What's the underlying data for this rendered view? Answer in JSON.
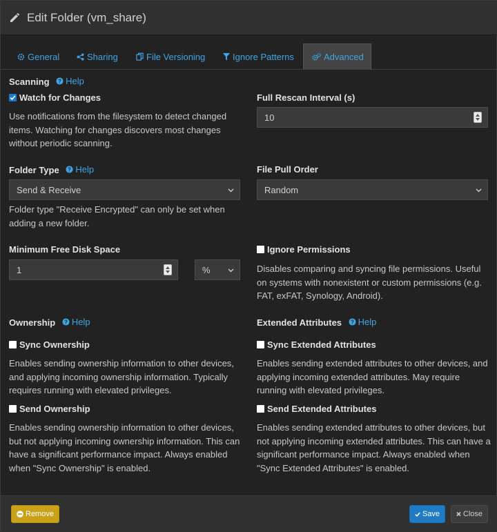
{
  "modal": {
    "title": "Edit Folder (vm_share)"
  },
  "tabs": [
    {
      "label": "General",
      "icon": "gear-icon"
    },
    {
      "label": "Sharing",
      "icon": "share-icon"
    },
    {
      "label": "File Versioning",
      "icon": "files-icon"
    },
    {
      "label": "Ignore Patterns",
      "icon": "filter-icon"
    },
    {
      "label": "Advanced",
      "icon": "cogs-icon",
      "active": true
    }
  ],
  "help_label": "Help",
  "scanning": {
    "label": "Scanning",
    "watch_label": "Watch for Changes",
    "watch_checked": true,
    "watch_description_lines": [
      "Use notifications from the filesystem to detect changed",
      "items. Watching for changes discovers most changes",
      "without periodic scanning."
    ]
  },
  "rescan": {
    "label": "Full Rescan Interval (s)",
    "value": "10"
  },
  "folder_type": {
    "label": "Folder Type",
    "value": "Send & Receive",
    "note_lines": [
      "Folder type \"Receive Encrypted\" can only be set when",
      "adding a new folder."
    ]
  },
  "pull_order": {
    "label": "File Pull Order",
    "value": "Random"
  },
  "min_disk": {
    "label": "Minimum Free Disk Space",
    "value": "1",
    "unit": "%"
  },
  "ignore_permissions": {
    "label": "Ignore Permissions",
    "checked": false,
    "description_lines": [
      "Disables comparing and syncing file permissions. Useful",
      "on systems with nonexistent or custom permissions (e.g.",
      "FAT, exFAT, Synology, Android)."
    ]
  },
  "ownership": {
    "label": "Ownership",
    "sync_label": "Sync Ownership",
    "sync_checked": false,
    "sync_description_lines": [
      "Enables sending ownership information to other devices,",
      "and applying incoming ownership information. Typically",
      "requires running with elevated privileges."
    ],
    "send_label": "Send Ownership",
    "send_checked": false,
    "send_description_lines": [
      "Enables sending ownership information to other devices,",
      "but not applying incoming ownership information. This can",
      "have a significant performance impact. Always enabled",
      "when \"Sync Ownership\" is enabled."
    ]
  },
  "xattrs": {
    "label": "Extended Attributes",
    "sync_label": "Sync Extended Attributes",
    "sync_checked": false,
    "sync_description_lines": [
      "Enables sending extended attributes to other devices, and",
      "applying incoming extended attributes. May require",
      "running with elevated privileges."
    ],
    "send_label": "Send Extended Attributes",
    "send_checked": false,
    "send_description_lines": [
      "Enables sending extended attributes to other devices, but",
      "not applying incoming extended attributes. This can have a",
      "significant performance impact. Always enabled when",
      "\"Sync Extended Attributes\" is enabled."
    ]
  },
  "footer": {
    "remove_label": "Remove",
    "save_label": "Save",
    "close_label": "Close"
  },
  "colors": {
    "accent": "#3ea6e4",
    "remove": "#c9a21a",
    "save": "#1e7bc4",
    "background": "#222222",
    "header": "#303030"
  }
}
